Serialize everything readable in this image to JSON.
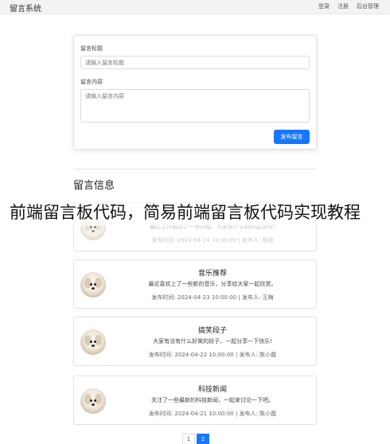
{
  "app": {
    "title": "留言系统",
    "nav": [
      "登录",
      "注册",
      "后台管理"
    ]
  },
  "form": {
    "title_label": "留言标题",
    "title_placeholder": "请输入留言标题",
    "content_label": "留言内容",
    "content_placeholder": "请输入留言内容",
    "submit_label": "发布留言"
  },
  "list": {
    "heading": "留言信息",
    "items": [
      {
        "title": "",
        "content": "最近工作遇到了一些问题，大家有什么好的建议吗?",
        "meta": "发布时间: 2024-04-24 10:00:00 | 发布人: 陈晨"
      },
      {
        "title": "音乐推荐",
        "content": "最近喜欢上了一些新的音乐，分享给大家一起欣赏。",
        "meta": "发布时间: 2024-04-23 10:00:00 | 发布人: 王梅"
      },
      {
        "title": "搞笑段子",
        "content": "大家有没有什么好笑的段子，一起分享一下快乐!",
        "meta": "发布时间: 2024-04-22 10:00:00 | 发布人: 陈小霞"
      },
      {
        "title": "科技新闻",
        "content": "关注了一些最新的科技新闻，一起来讨论一下吧。",
        "meta": "发布时间: 2024-04-21 10:00:00 | 发布人: 陈小霞"
      }
    ]
  },
  "pagination": {
    "pages": [
      "1",
      "2"
    ],
    "current": "2"
  },
  "overlay_caption": "前端留言板代码，简易前端留言板代码实现教程",
  "colors": {
    "accent": "#1677ff",
    "topbar": "#f3f3f3"
  }
}
